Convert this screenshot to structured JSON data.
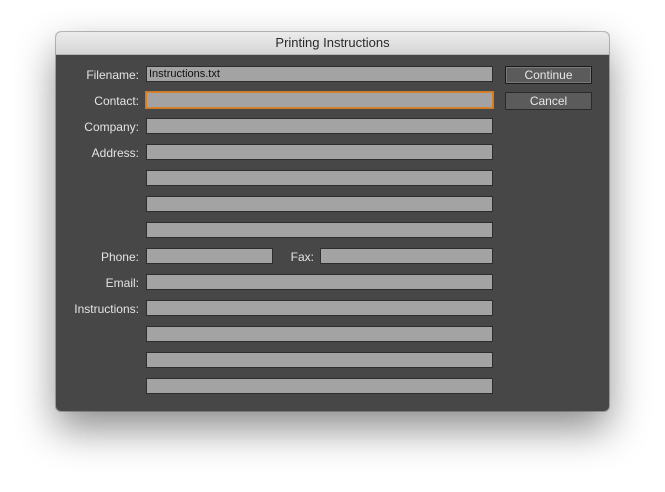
{
  "window": {
    "title": "Printing Instructions"
  },
  "form": {
    "filename_label": "Filename:",
    "filename_value": "Instructions.txt",
    "contact_label": "Contact:",
    "contact_value": "",
    "company_label": "Company:",
    "company_value": "",
    "address_label": "Address:",
    "address_lines": [
      "",
      "",
      "",
      ""
    ],
    "phone_label": "Phone:",
    "phone_value": "",
    "fax_label": "Fax:",
    "fax_value": "",
    "email_label": "Email:",
    "email_value": "",
    "instructions_label": "Instructions:",
    "instructions_lines": [
      "",
      "",
      "",
      ""
    ]
  },
  "buttons": {
    "continue_label": "Continue",
    "cancel_label": "Cancel"
  },
  "colors": {
    "dialog_bg": "#474747",
    "field_bg": "#a3a3a3",
    "focus_ring": "#d9822b"
  }
}
